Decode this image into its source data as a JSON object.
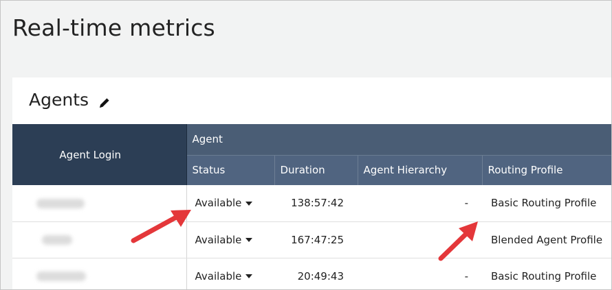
{
  "page": {
    "title": "Real-time metrics"
  },
  "panel": {
    "title": "Agents",
    "edit_icon": "pencil-icon"
  },
  "table": {
    "login_header": "Agent Login",
    "group_header": "Agent",
    "columns": [
      "Status",
      "Duration",
      "Agent Hierarchy",
      "Routing Profile"
    ],
    "rows": [
      {
        "status": "Available",
        "duration": "138:57:42",
        "hierarchy": "-",
        "profile": "Basic Routing Profile"
      },
      {
        "status": "Available",
        "duration": "167:47:25",
        "hierarchy": "-",
        "profile": "Blended Agent Profile"
      },
      {
        "status": "Available",
        "duration": "20:49:43",
        "hierarchy": "-",
        "profile": "Basic Routing Profile"
      }
    ]
  },
  "icons": {
    "status_dropdown": "caret-down-icon",
    "annotation": "red-arrow-icon"
  },
  "colors": {
    "header_dark": "#2c3e55",
    "header_group": "#4a5d75",
    "header_sub": "#506480",
    "annotation_arrow": "#e4373a"
  }
}
